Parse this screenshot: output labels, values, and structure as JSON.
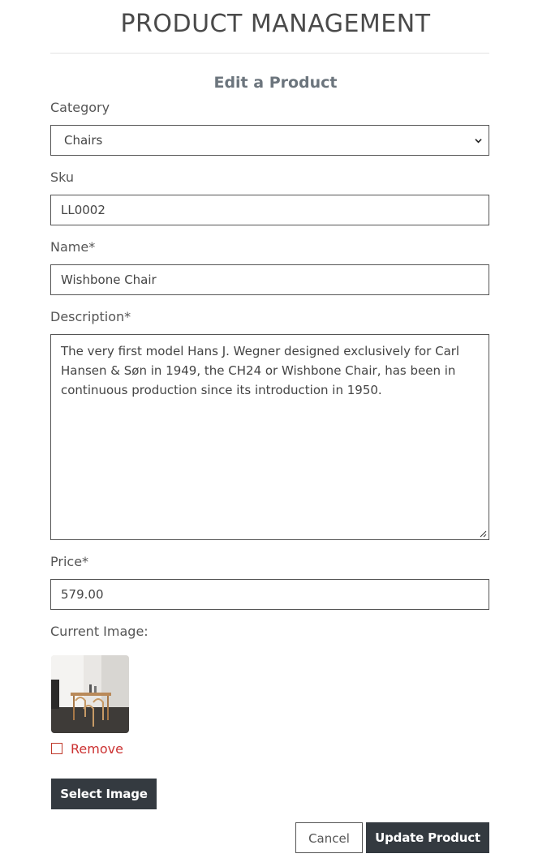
{
  "header": {
    "title": "PRODUCT MANAGEMENT",
    "subtitle": "Edit a Product"
  },
  "form": {
    "category": {
      "label": "Category",
      "value": "Chairs"
    },
    "sku": {
      "label": "Sku",
      "value": "LL0002"
    },
    "name": {
      "label": "Name*",
      "value": "Wishbone Chair"
    },
    "description": {
      "label": "Description*",
      "value": "The very first model Hans J. Wegner designed exclusively for Carl Hansen & Søn in 1949, the CH24 or Wishbone Chair, has been in continuous production since its introduction in 1950."
    },
    "price": {
      "label": "Price*",
      "value": "579.00"
    },
    "image": {
      "label": "Current Image:",
      "remove_label": "Remove",
      "remove_checked": false,
      "select_button": "Select Image"
    }
  },
  "actions": {
    "cancel_label": "Cancel",
    "submit_label": "Update Product"
  },
  "colors": {
    "dark_button": "#343a40",
    "remove_red": "#cc3333",
    "border": "#555555"
  }
}
